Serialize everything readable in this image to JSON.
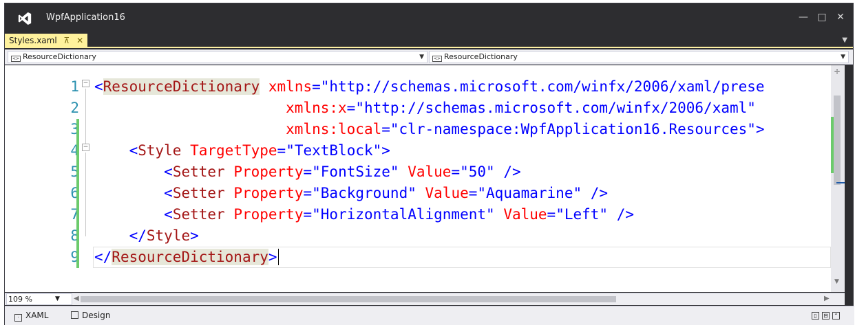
{
  "window": {
    "title": "WpfApplication16"
  },
  "tabs": [
    {
      "label": "Styles.xaml"
    }
  ],
  "navigation": {
    "left_combo": "ResourceDictionary",
    "right_combo": "ResourceDictionary"
  },
  "editor": {
    "line_numbers": [
      "1",
      "2",
      "3",
      "4",
      "5",
      "6",
      "7",
      "8",
      "9"
    ],
    "lines": [
      [
        [
          "br",
          "<"
        ],
        [
          "el",
          "ResourceDictionary"
        ],
        [
          "pl",
          " "
        ],
        [
          "at",
          "xmlns"
        ],
        [
          "eq",
          "="
        ],
        [
          "val",
          "\"http://schemas.microsoft.com/winfx/2006/xaml/prese"
        ]
      ],
      [
        [
          "pl",
          "                      "
        ],
        [
          "at",
          "xmlns:x"
        ],
        [
          "eq",
          "="
        ],
        [
          "val",
          "\"http://schemas.microsoft.com/winfx/2006/xaml\""
        ]
      ],
      [
        [
          "pl",
          "                      "
        ],
        [
          "at",
          "xmlns:local"
        ],
        [
          "eq",
          "="
        ],
        [
          "val",
          "\"clr-namespace:WpfApplication16.Resources\""
        ],
        [
          "br",
          ">"
        ]
      ],
      [
        [
          "pl",
          "    "
        ],
        [
          "br",
          "<"
        ],
        [
          "el",
          "Style"
        ],
        [
          "pl",
          " "
        ],
        [
          "at",
          "TargetType"
        ],
        [
          "eq",
          "="
        ],
        [
          "val",
          "\"TextBlock\""
        ],
        [
          "br",
          ">"
        ]
      ],
      [
        [
          "pl",
          "        "
        ],
        [
          "br",
          "<"
        ],
        [
          "el",
          "Setter"
        ],
        [
          "pl",
          " "
        ],
        [
          "at",
          "Property"
        ],
        [
          "eq",
          "="
        ],
        [
          "val",
          "\"FontSize\""
        ],
        [
          "pl",
          " "
        ],
        [
          "at",
          "Value"
        ],
        [
          "eq",
          "="
        ],
        [
          "val",
          "\"50\""
        ],
        [
          "pl",
          " "
        ],
        [
          "br",
          "/>"
        ]
      ],
      [
        [
          "pl",
          "        "
        ],
        [
          "br",
          "<"
        ],
        [
          "el",
          "Setter"
        ],
        [
          "pl",
          " "
        ],
        [
          "at",
          "Property"
        ],
        [
          "eq",
          "="
        ],
        [
          "val",
          "\"Background\""
        ],
        [
          "pl",
          " "
        ],
        [
          "at",
          "Value"
        ],
        [
          "eq",
          "="
        ],
        [
          "val",
          "\"Aquamarine\""
        ],
        [
          "pl",
          " "
        ],
        [
          "br",
          "/>"
        ]
      ],
      [
        [
          "pl",
          "        "
        ],
        [
          "br",
          "<"
        ],
        [
          "el",
          "Setter"
        ],
        [
          "pl",
          " "
        ],
        [
          "at",
          "Property"
        ],
        [
          "eq",
          "="
        ],
        [
          "val",
          "\"HorizontalAlignment\""
        ],
        [
          "pl",
          " "
        ],
        [
          "at",
          "Value"
        ],
        [
          "eq",
          "="
        ],
        [
          "val",
          "\"Left\""
        ],
        [
          "pl",
          " "
        ],
        [
          "br",
          "/>"
        ]
      ],
      [
        [
          "pl",
          "    "
        ],
        [
          "br",
          "</"
        ],
        [
          "el",
          "Style"
        ],
        [
          "br",
          ">"
        ]
      ],
      [
        [
          "br",
          "</"
        ],
        [
          "el",
          "ResourceDictionary"
        ],
        [
          "br",
          ">"
        ]
      ]
    ]
  },
  "status": {
    "zoom": "109 %"
  },
  "view_tabs": {
    "xaml": "XAML",
    "design": "Design"
  },
  "colors": {
    "chrome": "#2d2d30",
    "active_tab": "#fff29d",
    "line_number": "#2b91af",
    "element": "#a31515",
    "attribute": "#ff0000",
    "value": "#0000ff",
    "change_bar": "#6ccb6c"
  }
}
